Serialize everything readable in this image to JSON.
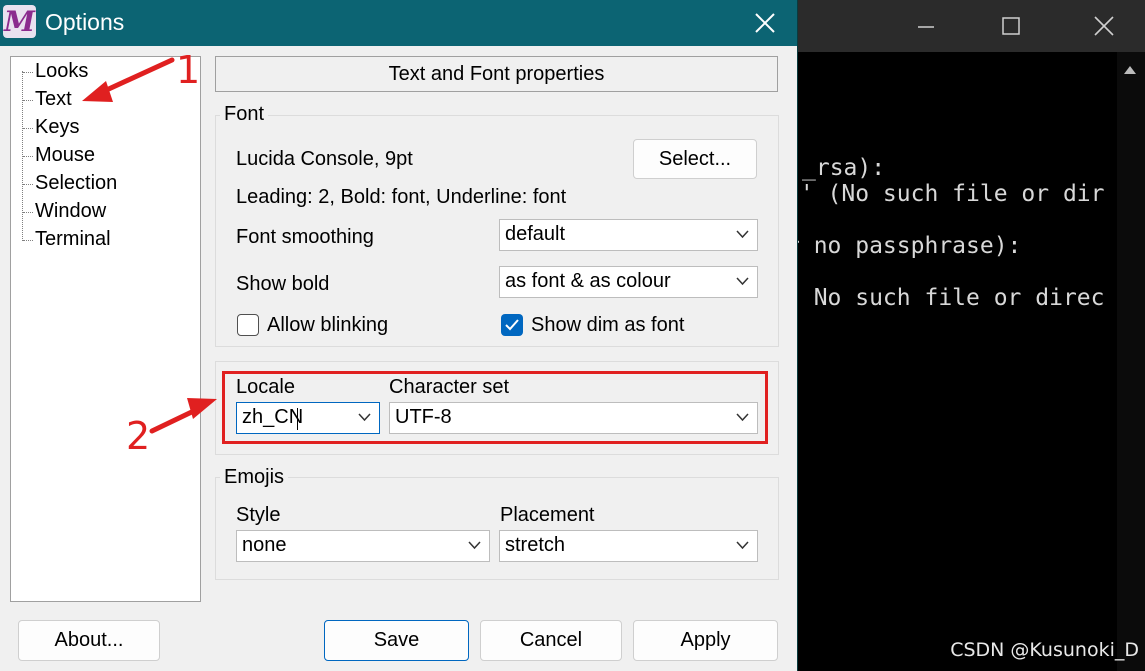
{
  "dialog": {
    "title": "Options",
    "app_icon_letter": "M"
  },
  "tree": {
    "items": [
      "Looks",
      "Text",
      "Keys",
      "Mouse",
      "Selection",
      "Window",
      "Terminal"
    ],
    "selected": "Text"
  },
  "page_header": "Text and Font properties",
  "font_group": {
    "label": "Font",
    "font_name": "Lucida Console, 9pt",
    "select_button": "Select...",
    "details": "Leading: 2, Bold: font, Underline: font",
    "smoothing_label": "Font smoothing",
    "smoothing_value": "default",
    "show_bold_label": "Show bold",
    "show_bold_value": "as font & as colour",
    "allow_blinking_label": "Allow blinking",
    "allow_blinking_checked": false,
    "show_dim_label": "Show dim as font",
    "show_dim_checked": true
  },
  "locale_group": {
    "locale_label": "Locale",
    "locale_value": "zh_CN",
    "charset_label": "Character set",
    "charset_value": "UTF-8"
  },
  "emojis_group": {
    "label": "Emojis",
    "style_label": "Style",
    "style_value": "none",
    "placement_label": "Placement",
    "placement_value": "stretch"
  },
  "buttons": {
    "about": "About...",
    "save": "Save",
    "cancel": "Cancel",
    "apply": "Apply"
  },
  "annotations": {
    "step1": "1",
    "step2": "2",
    "color": "#e02020"
  },
  "terminal": {
    "lines": [
      "_rsa):",
      "n' (No such file or dir",
      "r no passphrase):",
      ": No such file or direc"
    ]
  },
  "watermark": "CSDN @Kusunoki_D",
  "colors": {
    "titlebar": "#0c6473",
    "accent": "#0067c0",
    "highlight_box": "#e02020"
  }
}
